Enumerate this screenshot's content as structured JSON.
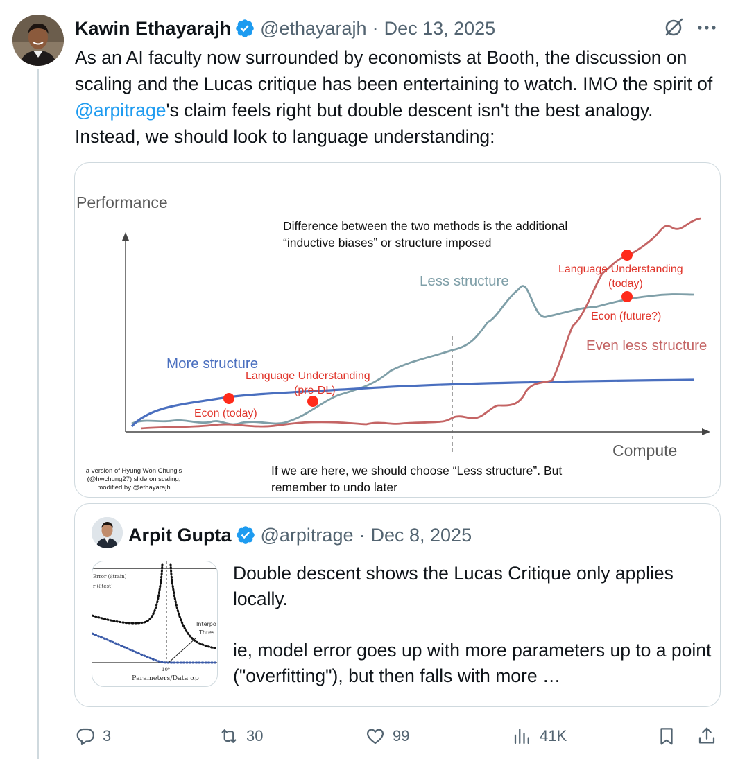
{
  "tweet": {
    "author": {
      "display_name": "Kawin Ethayarajh",
      "handle": "@ethayarajh",
      "separator": "·",
      "date": "Dec 13, 2025"
    },
    "text_parts": [
      "As an AI faculty now surrounded by economists at Booth, the discussion on scaling and the Lucas critique has been entertaining to watch. IMO the spirit of ",
      "@arpitrage",
      "'s claim feels right but double descent isn't the best analogy. Instead, we should look to language understanding:"
    ],
    "icons": [
      "verified-badge-icon",
      "grok-icon",
      "more-icon"
    ]
  },
  "slide": {
    "y_axis_label": "Performance",
    "x_axis_label": "Compute",
    "top_note_line1": "Difference between the two methods is the additional",
    "top_note_line2": "“inductive biases” or structure imposed",
    "less_structure": "Less structure",
    "more_structure": "More structure",
    "even_less_structure": "Even less structure",
    "lang_today_line1": "Language Understanding",
    "lang_today_line2": "(today)",
    "econ_future": "Econ (future?)",
    "lang_predl_line1": "Language Understanding",
    "lang_predl_line2": "(pre-DL)",
    "econ_today": "Econ (today)",
    "bottom_note_line1": "If we are here, we should choose “Less structure”. But",
    "bottom_note_line2": "remember to undo later",
    "credit_line1": "a version of Hyung Won Chung's",
    "credit_line2": "(@hwchung27) slide on scaling,",
    "credit_line3": "modified by @ethayarajh",
    "colors": {
      "more_structure": "#4a6fbf",
      "less_structure": "#7f9fa8",
      "even_less_structure": "#c46464",
      "marker": "#ff2a1a",
      "annotation": "#e0352b"
    }
  },
  "quote": {
    "author": {
      "display_name": "Arpit Gupta",
      "handle": "@arpitrage",
      "separator": "·",
      "date": "Dec 8, 2025"
    },
    "text_para1": "Double descent shows the Lucas Critique only applies locally.",
    "text_para2": "ie, model error goes up with more parameters up to a point (\"overfitting\"), but then falls with more …",
    "thumbnail": {
      "legend_1": "Error (ℰtrain)",
      "legend_2": "r (ℰtest)",
      "annotation_1": "Interpo",
      "annotation_2": "Thres",
      "tick": "10⁰",
      "xlabel": "Parameters/Data αp"
    }
  },
  "actions": {
    "replies": "3",
    "reposts": "30",
    "likes": "99",
    "views": "41K",
    "icons": [
      "reply-icon",
      "repost-icon",
      "like-icon",
      "views-icon",
      "bookmark-icon",
      "share-icon"
    ]
  }
}
